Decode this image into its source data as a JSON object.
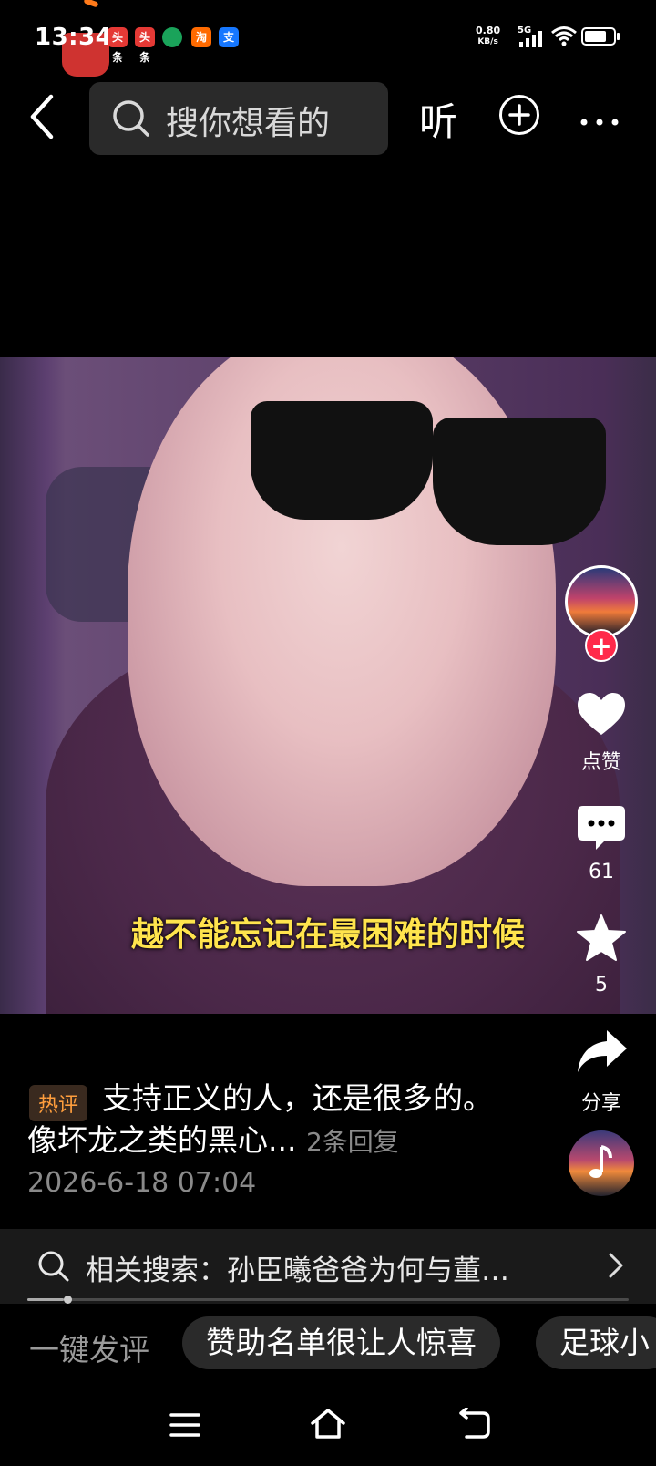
{
  "status_bar": {
    "time": "13:34",
    "net_speed_value": "0.80",
    "net_speed_unit": "KB/s",
    "network": "5G",
    "battery_level": 0.75,
    "notification_icons": [
      {
        "name": "toutiao-app-icon",
        "text": "头条",
        "color": "#e53935"
      },
      {
        "name": "toutiao-lite-app-icon",
        "text": "头条",
        "color": "#e53935"
      },
      {
        "name": "green-app-icon",
        "text": "",
        "color": "#1aa35a"
      },
      {
        "name": "taobao-app-icon",
        "text": "淘",
        "color": "#ff6a00"
      },
      {
        "name": "alipay-app-icon",
        "text": "支",
        "color": "#1677ff"
      }
    ]
  },
  "top_bar": {
    "search_placeholder": "搜你想看的",
    "listen_label": "听"
  },
  "video": {
    "subtitle": "越不能忘记在最困难的时候"
  },
  "right_rail": {
    "like_label": "点赞",
    "comment_count": "61",
    "favorite_count": "5",
    "share_label": "分享"
  },
  "comment": {
    "tag": "热评",
    "line1": "支持正义的人，还是很多的。",
    "line2": "像坏龙之类的黑心...",
    "replies": "2条回复",
    "date": "2026-6-18 07:04"
  },
  "related_search": {
    "text": "相关搜索：孙臣曦爸爸为何与董…",
    "progress": 0.06
  },
  "quick_comment": {
    "label": "一键发评",
    "chips": [
      "赞助名单很让人惊喜",
      "足球小"
    ]
  },
  "colors": {
    "accent_red": "#ff2a4a",
    "subtitle_yellow": "#ffe44d",
    "hot_tag_orange": "#ff9e3d"
  }
}
